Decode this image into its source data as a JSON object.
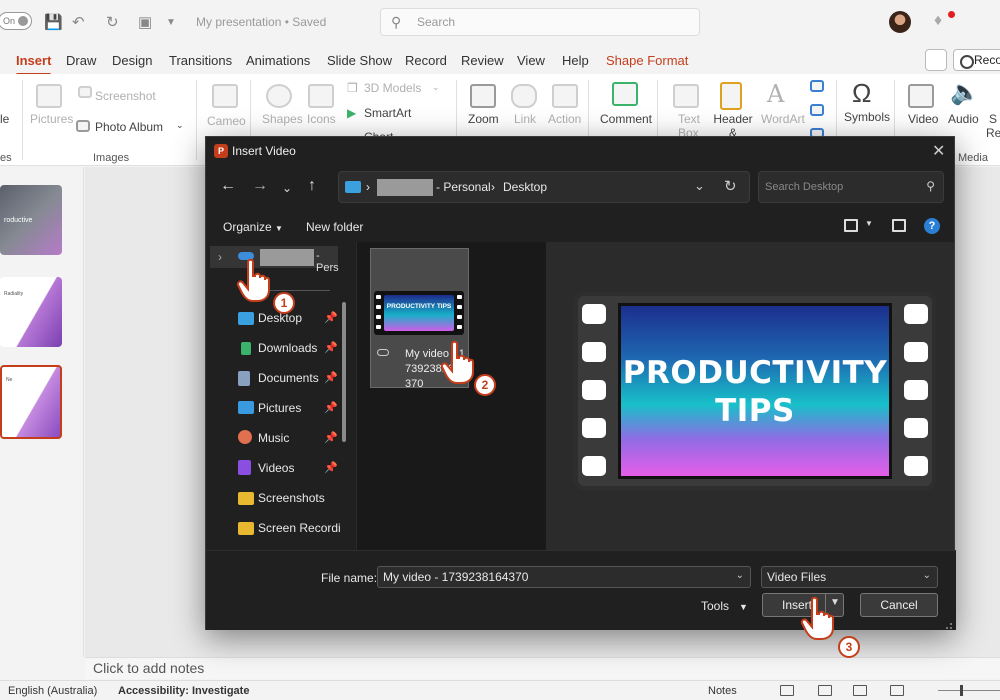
{
  "titlebar": {
    "autosave_label": "On",
    "doc_title": "My presentation • Saved",
    "search_placeholder": "Search"
  },
  "tabs": [
    "Insert",
    "Draw",
    "Design",
    "Transitions",
    "Animations",
    "Slide Show",
    "Record",
    "Review",
    "View",
    "Help",
    "Shape Format"
  ],
  "record_label": "Reco",
  "ribbon": {
    "items": {
      "slide_partial": "le",
      "pictures": "Pictures",
      "screenshot": "Screenshot",
      "photo_album": "Photo Album",
      "cameo": "Cameo",
      "shapes": "Shapes",
      "icons": "Icons",
      "models3d": "3D Models",
      "smartart": "SmartArt",
      "chart": "Chart",
      "zoom": "Zoom",
      "link": "Link",
      "action": "Action",
      "comment": "Comment",
      "textbox": "Text Box",
      "header_footer": "Header & Footer",
      "wordart": "WordArt",
      "symbols": "Symbols",
      "video": "Video",
      "audio": "Audio",
      "screen_rec_partial": "S Rec"
    },
    "groups": {
      "slides_partial": "es",
      "images": "Images",
      "media": "Media"
    }
  },
  "slides": {
    "thumb1_text": "roductive",
    "thumb2_text": "Radiality",
    "thumb3_text": "Ne"
  },
  "notes_placeholder": "Click to add notes",
  "statusbar": {
    "language": "English (Australia)",
    "accessibility": "Accessibility: Investigate",
    "notes": "Notes"
  },
  "dialog": {
    "title": "Insert Video",
    "breadcrumb": [
      "- Personal",
      "Desktop"
    ],
    "search_placeholder": "Search Desktop",
    "organize": "Organize",
    "new_folder": "New folder",
    "onedrive_suffix": "- Pers",
    "nav_items": [
      {
        "label": "Desktop",
        "icon": "desktop-icon",
        "color": "#3aa0e0"
      },
      {
        "label": "Downloads",
        "icon": "download-icon",
        "color": "#3bb36b"
      },
      {
        "label": "Documents",
        "icon": "documents-icon",
        "color": "#8aa0c0"
      },
      {
        "label": "Pictures",
        "icon": "pictures-icon",
        "color": "#3a9ae0"
      },
      {
        "label": "Music",
        "icon": "music-icon",
        "color": "#e07050"
      },
      {
        "label": "Videos",
        "icon": "videos-icon",
        "color": "#8a4ee0"
      },
      {
        "label": "Screenshots",
        "icon": "folder-icon",
        "color": "#e8b830"
      },
      {
        "label": "Screen Recordin",
        "icon": "folder-icon",
        "color": "#e8b830"
      }
    ],
    "file": {
      "name": "My video - 1739238164370",
      "thumb_text": "PRODUCTIVITY TIPS"
    },
    "preview_text": "PRODUCTIVITY TIPS",
    "file_name_label": "File name:",
    "file_name_value": "My video - 1739238164370",
    "file_type": "Video Files",
    "tools": "Tools",
    "insert": "Insert",
    "cancel": "Cancel"
  },
  "steps": [
    "1",
    "2",
    "3"
  ],
  "colors": {
    "accent": "#c43e1c",
    "dialog_bg": "#202020"
  }
}
